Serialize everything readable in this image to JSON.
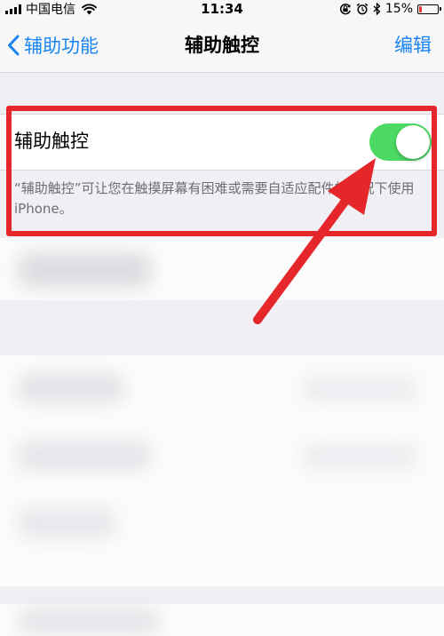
{
  "status_bar": {
    "carrier": "中国电信",
    "time": "11:34",
    "battery": "15%",
    "battery_level": 0.15,
    "battery_color": "#e53935",
    "icons": [
      "signal-icon",
      "wifi-icon",
      "rotation-lock-icon",
      "alarm-icon",
      "bluetooth-icon",
      "battery-icon"
    ]
  },
  "nav": {
    "back_label": "辅助功能",
    "title": "辅助触控",
    "action_label": "编辑",
    "tint_color": "#1a84f2"
  },
  "setting": {
    "label": "辅助触控",
    "toggle_on": true,
    "toggle_color": "#4cd964",
    "footer": "“辅助触控”可让您在触摸屏幕有困难或需要自适应配件的情况下使用 iPhone。"
  },
  "annotation": {
    "color": "#e5262b",
    "shapes": [
      "highlight-box",
      "arrow"
    ]
  }
}
